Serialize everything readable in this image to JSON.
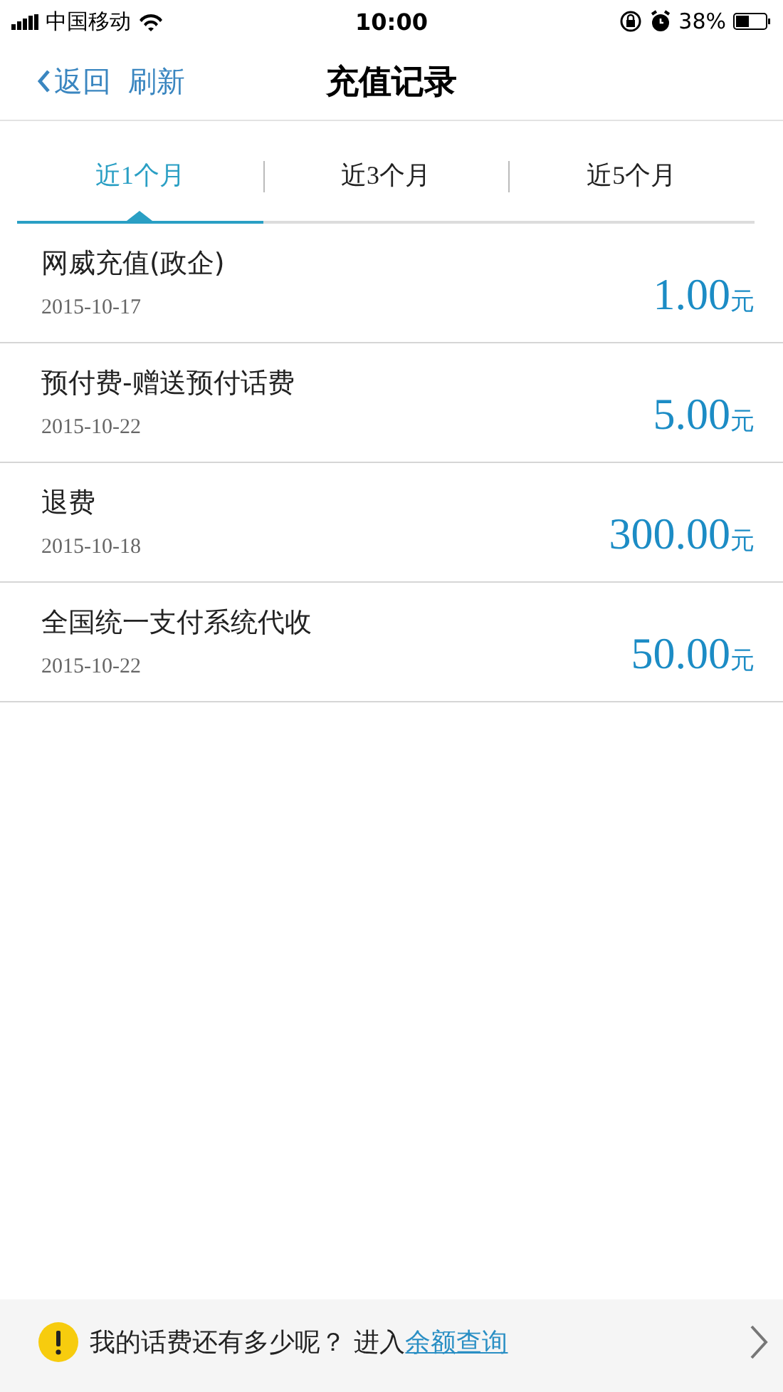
{
  "status_bar": {
    "carrier": "中国移动",
    "time": "10:00",
    "battery": "38%"
  },
  "nav": {
    "back": "返回",
    "refresh": "刷新",
    "title": "充值记录"
  },
  "tabs": [
    {
      "label": "近1个月",
      "selected": true
    },
    {
      "label": "近3个月",
      "selected": false
    },
    {
      "label": "近5个月",
      "selected": false
    }
  ],
  "records": [
    {
      "name": "网威充值(政企)",
      "date": "2015-10-17",
      "amount": "1.00",
      "unit": "元"
    },
    {
      "name": "预付费-赠送预付话费",
      "date": "2015-10-22",
      "amount": "5.00",
      "unit": "元"
    },
    {
      "name": "退费",
      "date": "2015-10-18",
      "amount": "300.00",
      "unit": "元"
    },
    {
      "name": "全国统一支付系统代收",
      "date": "2015-10-22",
      "amount": "50.00",
      "unit": "元"
    }
  ],
  "footer": {
    "text": "我的话费还有多少呢？ 进入",
    "link": "余额查询"
  }
}
